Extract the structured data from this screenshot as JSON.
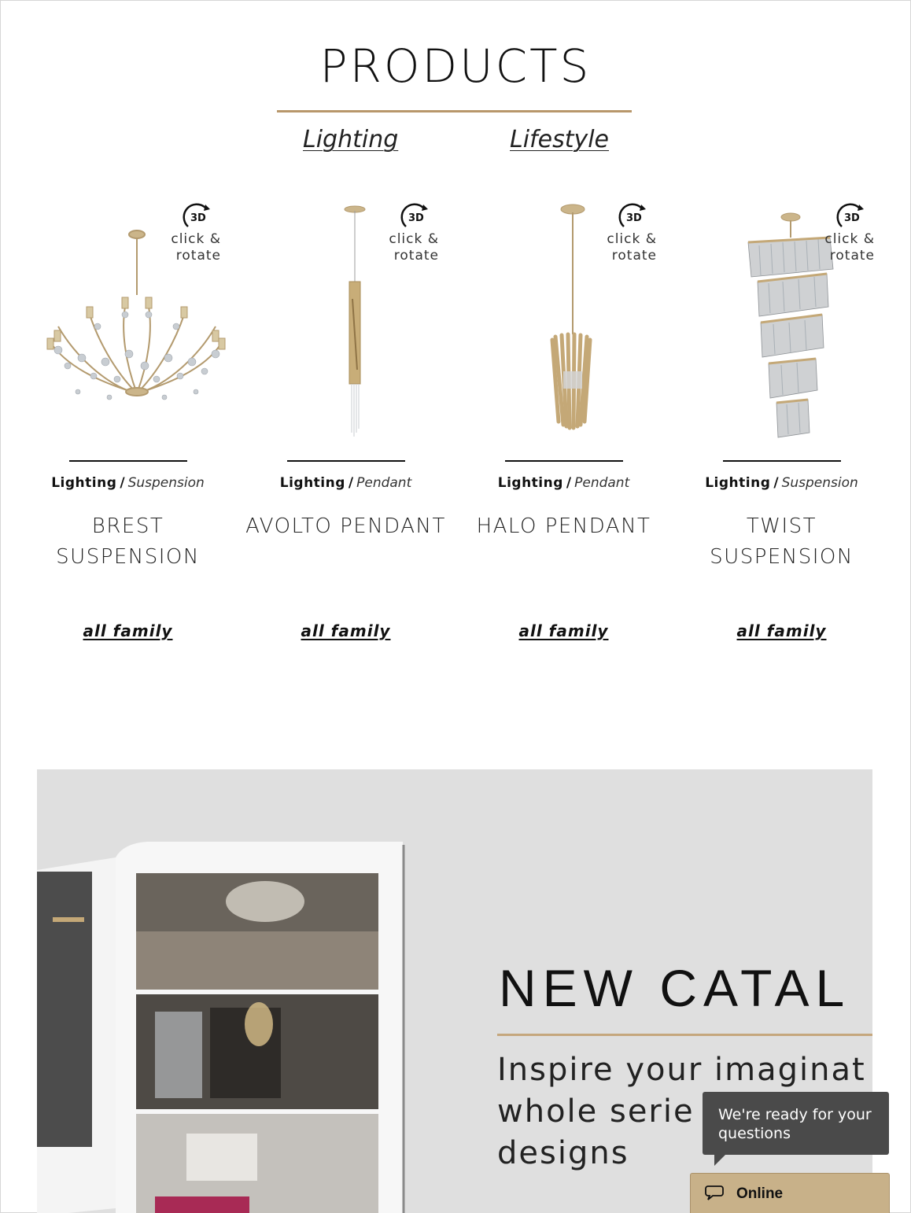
{
  "header": {
    "title": "PRODUCTS",
    "tabs": [
      {
        "label": "Lighting"
      },
      {
        "label": "Lifestyle"
      }
    ]
  },
  "products": [
    {
      "category": "Lighting",
      "separator": "/",
      "subcategory": "Suspension",
      "name": "BREST SUSPENSION",
      "family_link": "all family",
      "badge_icon_text": "3D",
      "badge_text": "click & rotate"
    },
    {
      "category": "Lighting",
      "separator": "/",
      "subcategory": "Pendant",
      "name": "AVOLTO PENDANT",
      "family_link": "all family",
      "badge_icon_text": "3D",
      "badge_text": "click & rotate"
    },
    {
      "category": "Lighting",
      "separator": "/",
      "subcategory": "Pendant",
      "name": "HALO PENDANT",
      "family_link": "all family",
      "badge_icon_text": "3D",
      "badge_text": "click & rotate"
    },
    {
      "category": "Lighting",
      "separator": "/",
      "subcategory": "Suspension",
      "name": "TWIST SUSPENSION",
      "family_link": "all family",
      "badge_icon_text": "3D",
      "badge_text": "click & rotate"
    }
  ],
  "banner": {
    "title": "NEW CATAL",
    "text_lines": [
      "Inspire your imaginat",
      "whole  serie",
      "designs"
    ]
  },
  "chat": {
    "bubble_text": "We're ready for your questions",
    "status_label": "Online"
  },
  "colors": {
    "accent_gold": "#b8976b",
    "chat_bar": "#c8b189",
    "chat_bubble": "#4a4a4a",
    "banner_bg": "#dfdfdf"
  }
}
